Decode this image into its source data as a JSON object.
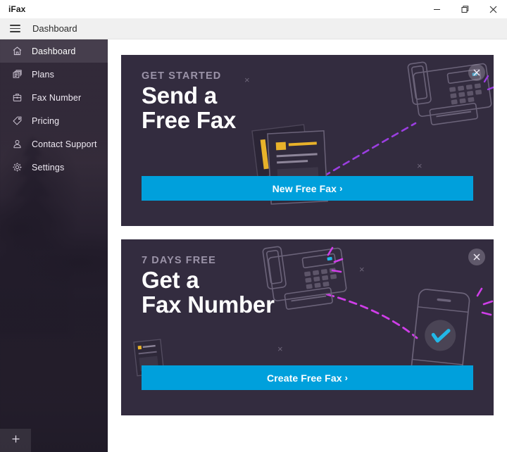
{
  "window": {
    "app_title": "iFax",
    "controls": [
      {
        "name": "minimize",
        "glyph": "minimize-icon"
      },
      {
        "name": "restore",
        "glyph": "restore-icon"
      },
      {
        "name": "close",
        "glyph": "close-icon"
      }
    ]
  },
  "menubar": {
    "hamburger_icon": "hamburger-menu-icon",
    "title": "Dashboard"
  },
  "sidebar": {
    "items": [
      {
        "label": "Dashboard",
        "icon": "home-icon",
        "active": true
      },
      {
        "label": "Plans",
        "icon": "stacked-papers-icon",
        "active": false
      },
      {
        "label": "Fax Number",
        "icon": "briefcase-icon",
        "active": false
      },
      {
        "label": "Pricing",
        "icon": "price-tag-icon",
        "active": false
      },
      {
        "label": "Contact Support",
        "icon": "person-icon",
        "active": false
      },
      {
        "label": "Settings",
        "icon": "gear-icon",
        "active": false
      }
    ],
    "add_button": {
      "label": "+",
      "icon": "plus-icon"
    }
  },
  "main": {
    "cards": [
      {
        "eyebrow": "GET STARTED",
        "headline": "Send a\nFree Fax",
        "cta_label": "New Free Fax",
        "cta_chevron": "›",
        "close_icon": "close-icon",
        "art": "fax-machine-and-documents-illustration"
      },
      {
        "eyebrow": "7 DAYS FREE",
        "headline": "Get a\nFax Number",
        "cta_label": "Create Free Fax",
        "cta_chevron": "›",
        "close_icon": "close-icon",
        "art": "fax-machine-and-phone-illustration"
      }
    ]
  },
  "colors": {
    "accent": "#00a0dc",
    "card_bg": "#332c3f",
    "sidebar_bg": "#2b2433",
    "titlebar_bg": "#ffffff",
    "menubar_bg": "#f0f0f0",
    "eyebrow": "#9b93a8",
    "art_line": "#6b6379",
    "art_purple": "#9b3ee0",
    "art_yellow": "#e8b22a"
  }
}
